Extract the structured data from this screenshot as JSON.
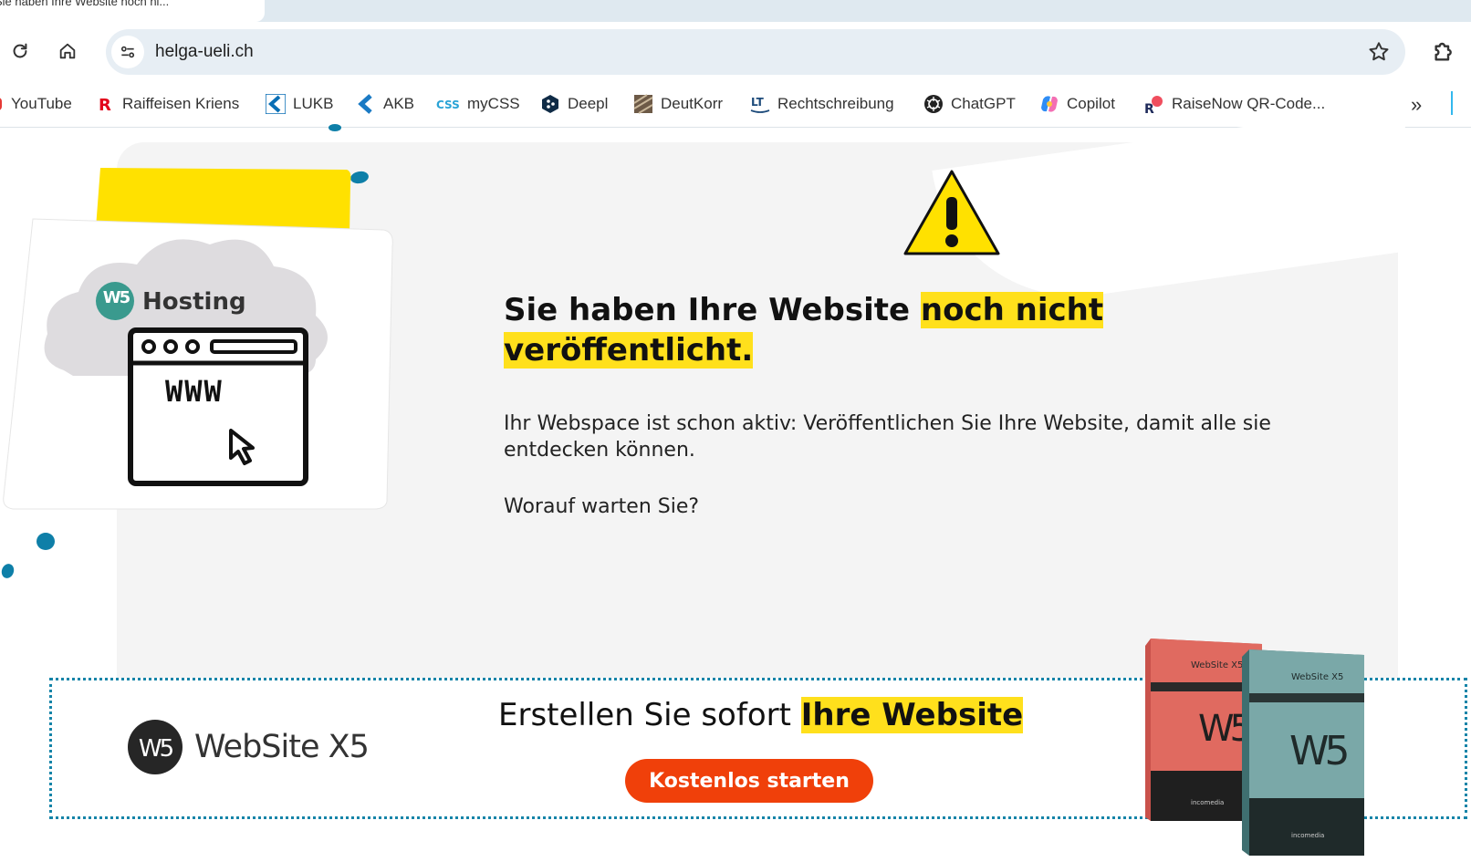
{
  "browser": {
    "tab_title": "Sie haben Ihre Website noch ni...",
    "url": "helga-ueli.ch",
    "bookmarks": [
      {
        "label": "YouTube",
        "icon": "youtube-icon"
      },
      {
        "label": "Raiffeisen Kriens",
        "icon": "raiffeisen-icon"
      },
      {
        "label": "LUKB",
        "icon": "lukb-icon"
      },
      {
        "label": "AKB",
        "icon": "akb-icon"
      },
      {
        "label": "myCSS",
        "icon": "css-icon"
      },
      {
        "label": "Deepl",
        "icon": "deepl-icon"
      },
      {
        "label": "DeutKorr",
        "icon": "deutkorr-icon"
      },
      {
        "label": "Rechtschreibung",
        "icon": "languagetool-icon"
      },
      {
        "label": "ChatGPT",
        "icon": "chatgpt-icon"
      },
      {
        "label": "Copilot",
        "icon": "copilot-icon"
      },
      {
        "label": "RaiseNow QR-Code...",
        "icon": "raisenow-icon"
      }
    ],
    "more_label": "»"
  },
  "illustration": {
    "cloud_label": "Hosting",
    "badge": "W5",
    "screen_text": "WWW"
  },
  "main": {
    "headline_plain": "Sie haben Ihre Website ",
    "headline_highlight_1": "noch nicht",
    "headline_highlight_2": "veröffentlicht.",
    "paragraph": "Ihr Webspace ist schon aktiv: Veröffentlichen Sie Ihre Website, damit alle sie entdecken können.",
    "question": "Worauf warten Sie?"
  },
  "banner": {
    "logo_text": "WebSite X5",
    "logo_badge": "W5",
    "promo_plain": "Erstellen Sie sofort ",
    "promo_highlight": "Ihre Website",
    "cta_label": "Kostenlos starten",
    "box_left_label": "WebSite X5",
    "box_right_label": "WebSite X5",
    "box_badge": "W5",
    "box_brand": "incomedia"
  },
  "colors": {
    "highlight": "#ffe01c",
    "cta": "#f0400a",
    "accent": "#1584a8"
  }
}
